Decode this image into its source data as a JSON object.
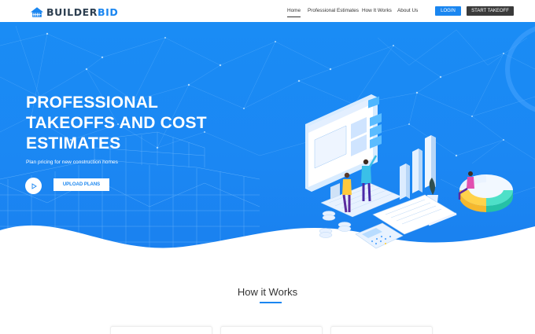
{
  "brand": {
    "name_part1": "BUILDER",
    "name_part2": "BID",
    "logo_icon": "house-icon",
    "brand_color": "#1a86f0"
  },
  "nav": {
    "items": [
      {
        "label": "Home",
        "active": true
      },
      {
        "label": "Professional Estimates",
        "active": false
      },
      {
        "label": "How It Works",
        "active": false
      },
      {
        "label": "About Us",
        "active": false
      }
    ],
    "login_label": "LOGIN",
    "start_label": "START TAKEOFF"
  },
  "hero": {
    "title_lines": [
      "PROFESSIONAL",
      "TAKEOFFS AND COST",
      "ESTIMATES"
    ],
    "subtitle": "Plan pricing for new construction homes",
    "play_icon": "play-icon",
    "upload_label": "UPLOAD PLANS",
    "background_color": "#1a86f0"
  },
  "how": {
    "title": "How it Works",
    "accent_color": "#1a86f0"
  }
}
